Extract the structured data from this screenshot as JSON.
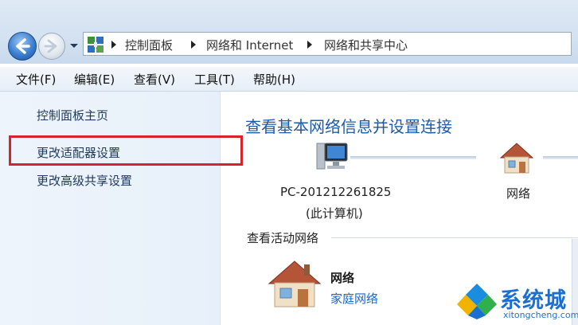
{
  "breadcrumb": [
    "控制面板",
    "网络和 Internet",
    "网络和共享中心"
  ],
  "menu": [
    "文件(F)",
    "编辑(E)",
    "查看(V)",
    "工具(T)",
    "帮助(H)"
  ],
  "left_pane": {
    "links": [
      "控制面板主页",
      "更改适配器设置",
      "更改高级共享设置"
    ]
  },
  "main": {
    "title": "查看基本网络信息并设置连接",
    "computer": {
      "name": "PC-201212261825",
      "label": "(此计算机)"
    },
    "network_label": "网络",
    "active_section_title": "查看活动网络",
    "active_network": {
      "name": "网络",
      "type": "家庭网络"
    }
  },
  "watermark": {
    "title": "系统城",
    "url": "xitongcheng.com"
  },
  "icons": [
    "back-icon",
    "forward-icon",
    "chevron-down-icon",
    "control-panel-icon",
    "computer-icon",
    "home-network-icon"
  ],
  "colors": {
    "highlight": "#d8232a",
    "title": "#1e5aa8",
    "link": "#1e66c8"
  }
}
